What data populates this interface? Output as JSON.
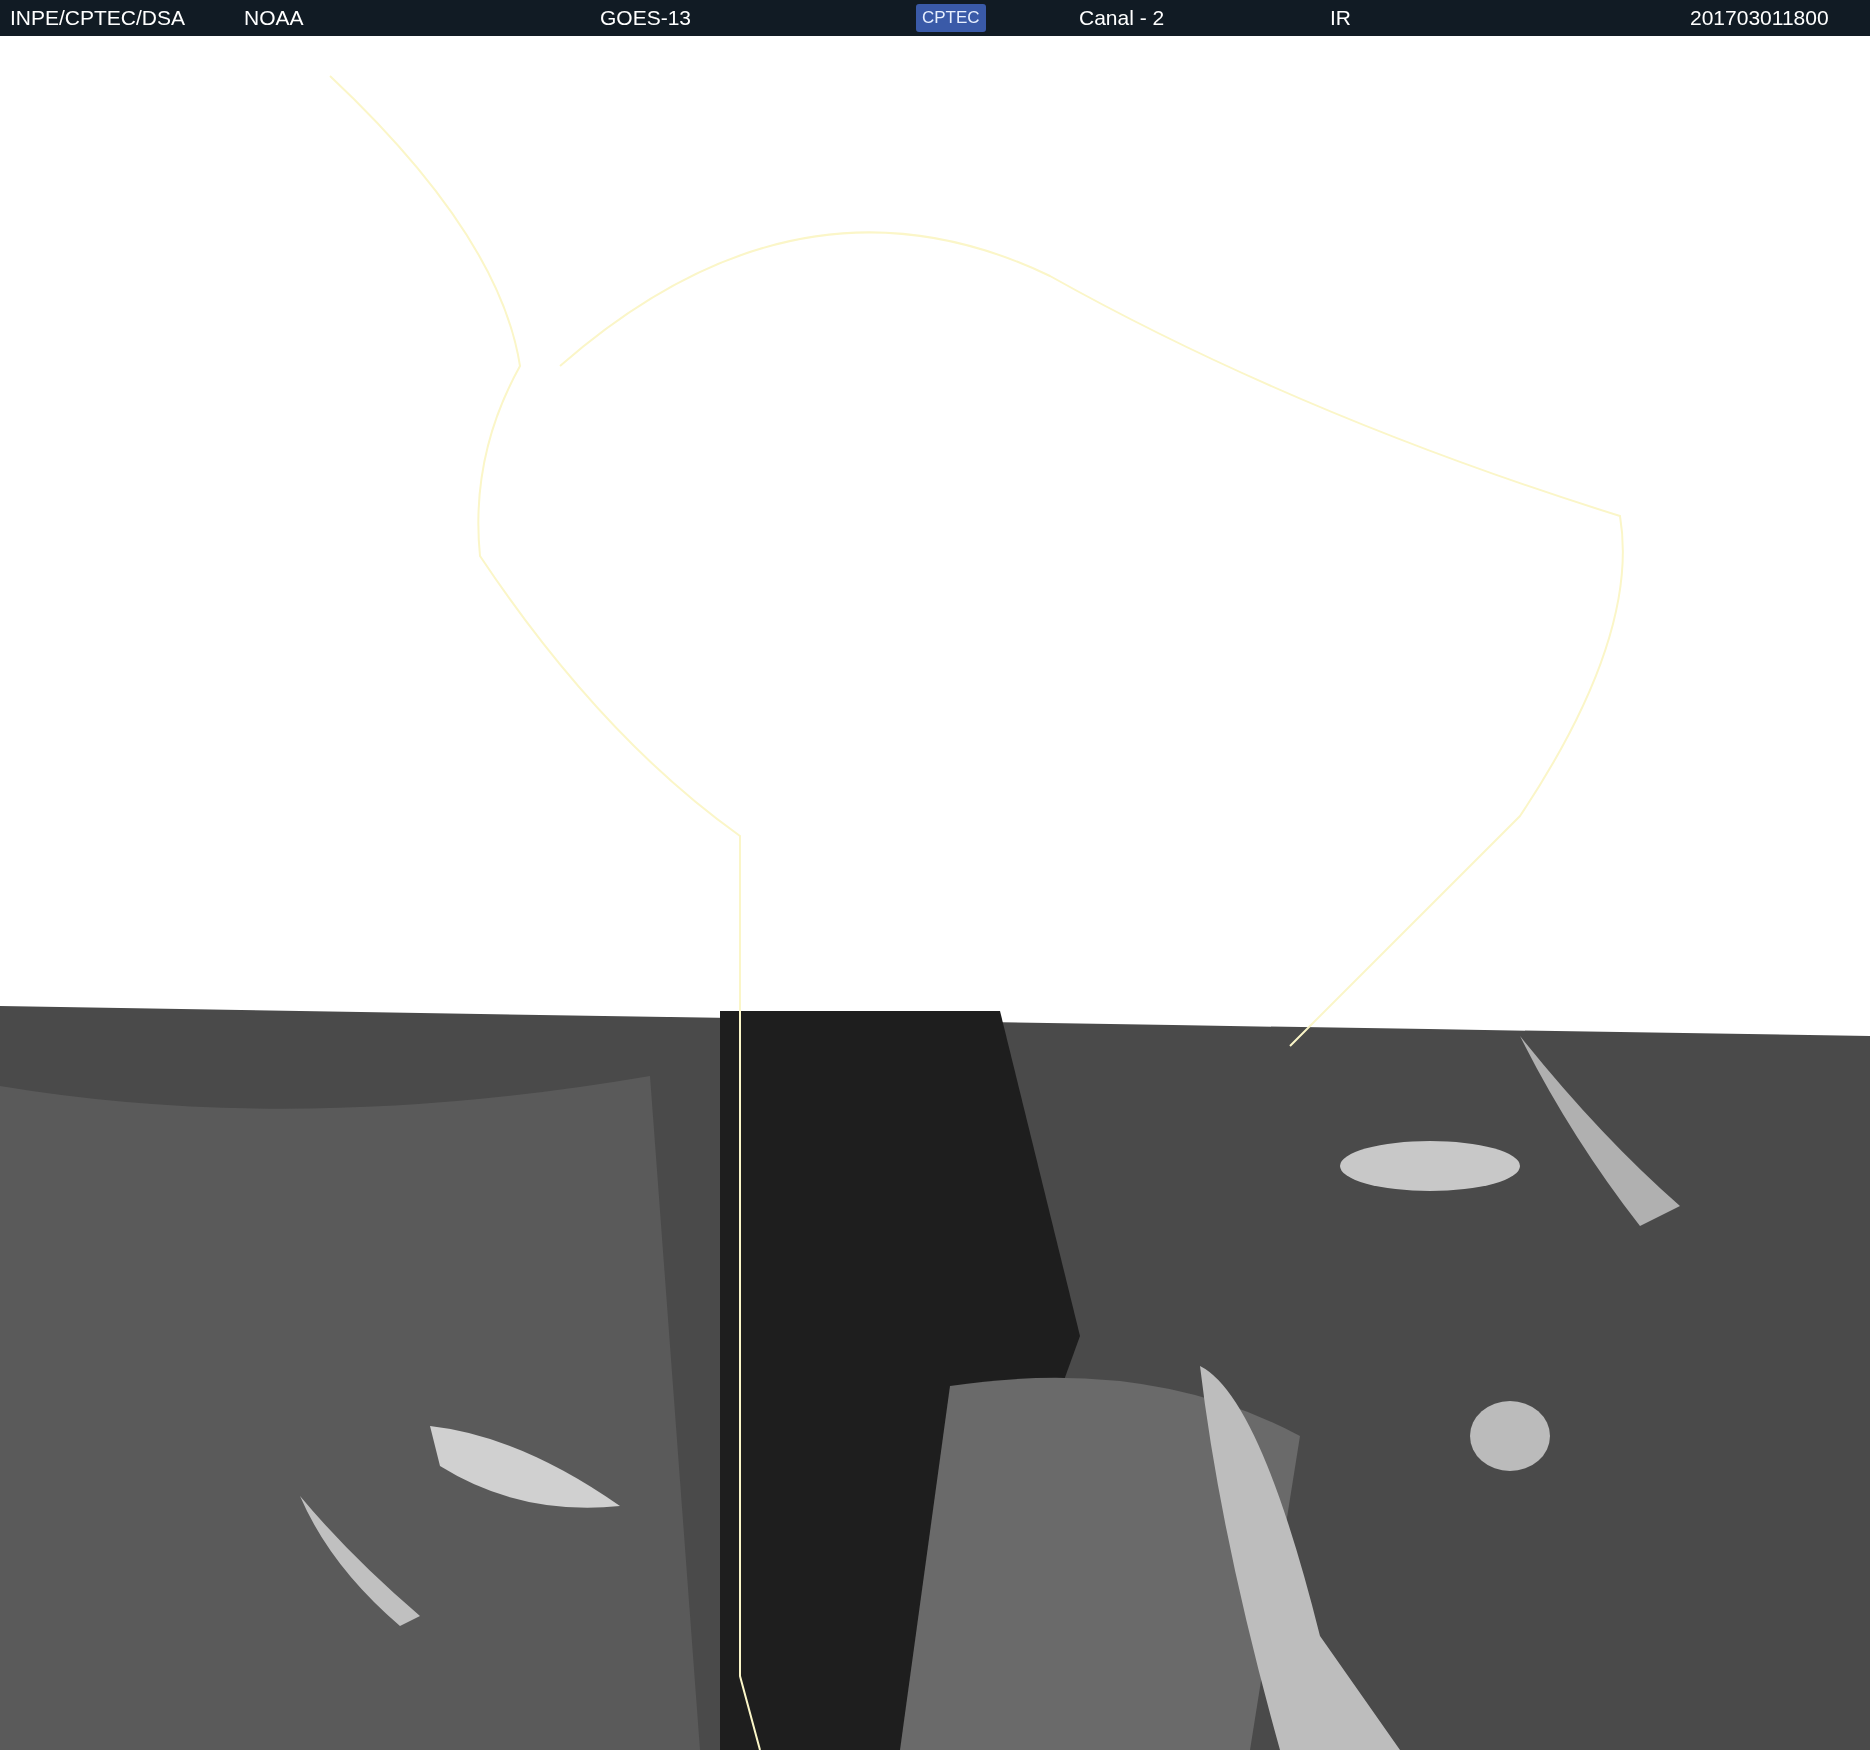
{
  "header": {
    "items": [
      {
        "kind": "text",
        "text": "INPE/CPTEC/DSA"
      },
      {
        "kind": "text",
        "text": "NOAA"
      },
      {
        "kind": "text",
        "text": "GOES-13"
      },
      {
        "kind": "logo",
        "text": "CPTEC"
      },
      {
        "kind": "text",
        "text": "Canal - 2"
      },
      {
        "kind": "text",
        "text": "IR"
      },
      {
        "kind": "text",
        "text": "201703011800"
      }
    ]
  }
}
